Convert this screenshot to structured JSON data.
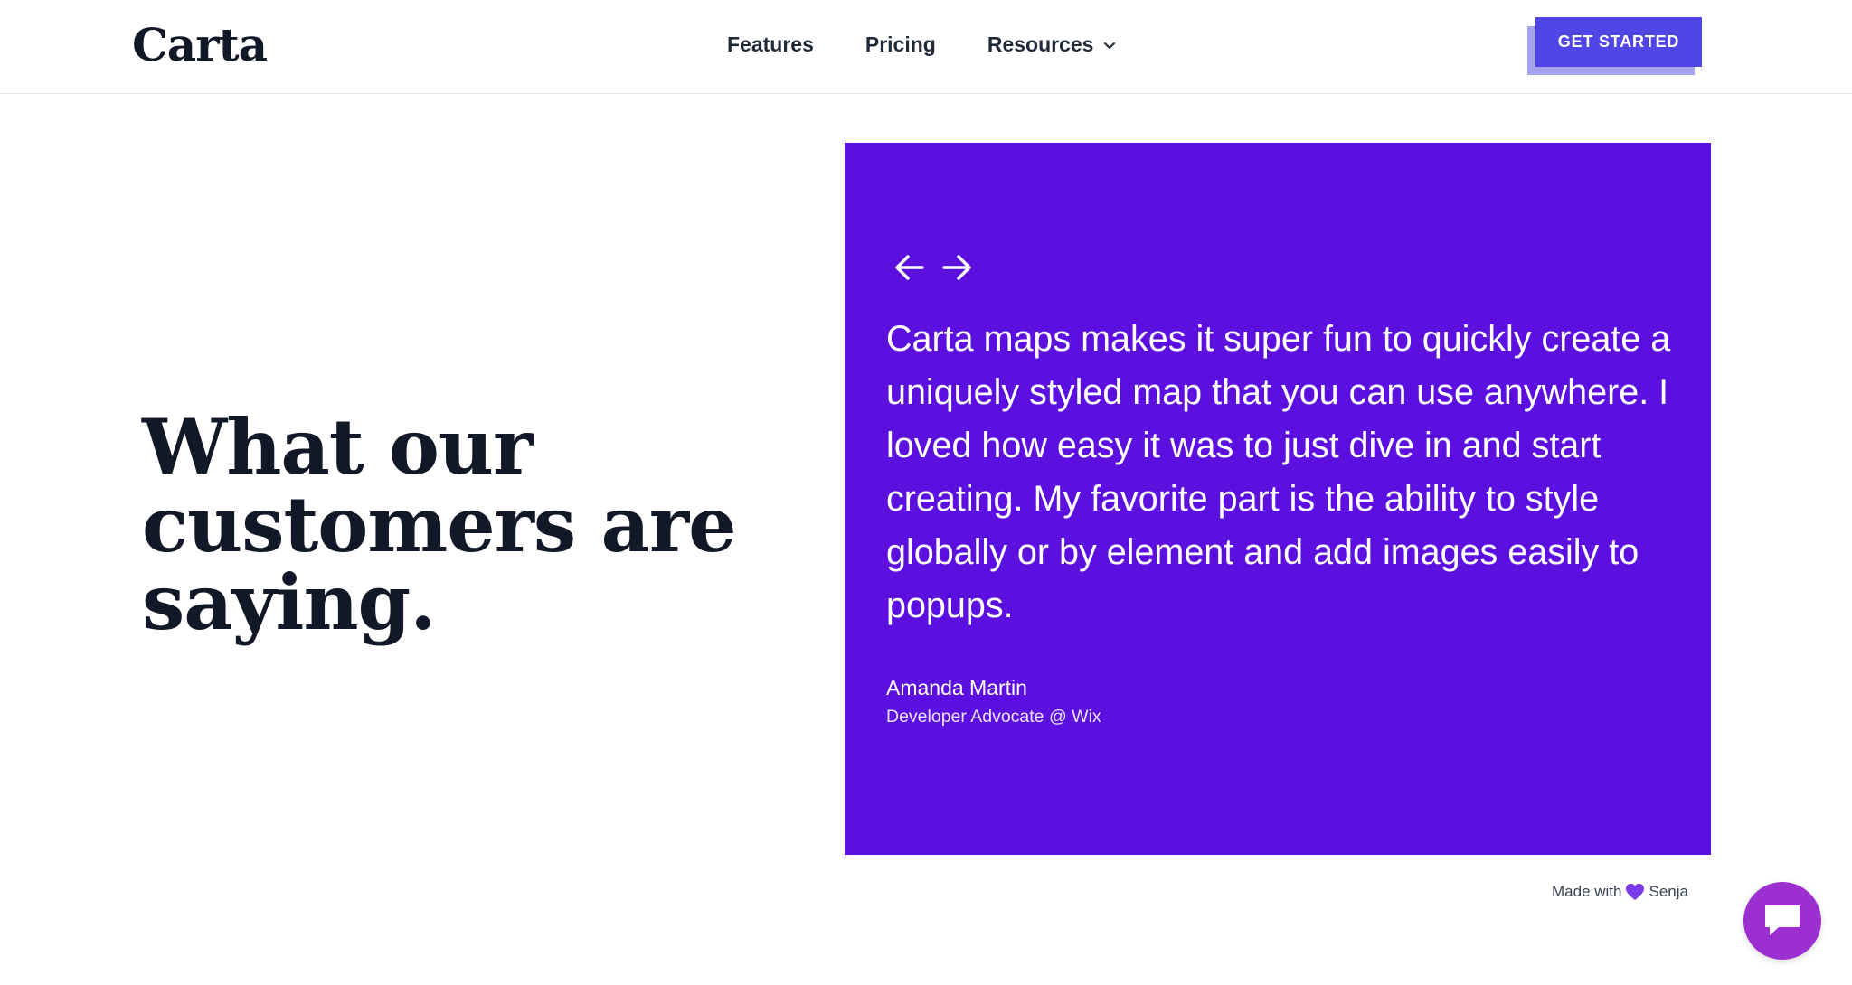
{
  "header": {
    "logo": "Carta",
    "nav": [
      {
        "label": "Features"
      },
      {
        "label": "Pricing"
      },
      {
        "label": "Resources",
        "has_dropdown": true
      }
    ],
    "cta_label": "GET STARTED"
  },
  "hero": {
    "heading_line1": "What our",
    "heading_highlight": "customers",
    "heading_line2_rest": " are",
    "heading_line3": "saying."
  },
  "testimonial": {
    "quote": "Carta maps makes it super fun to quickly create a uniquely styled map that you can use anywhere. I loved how easy it was to just dive in and start creating. My favorite part is the ability to style globally or by element and add images easily to popups.",
    "author_name": "Amanda Martin",
    "author_title": "Developer Advocate @ Wix",
    "prev_icon": "arrow-left-icon",
    "next_icon": "arrow-right-icon"
  },
  "badge": {
    "prefix": "Made with",
    "brand": "Senja",
    "icon": "heart-icon"
  },
  "chat": {
    "icon": "chat-bubble-icon"
  },
  "colors": {
    "text": "#111827",
    "accent": "#4f46e5",
    "card_bg": "#5c10df",
    "highlight": "#d6ebe3",
    "chat_bg": "#9b2fcf",
    "heart": "#7c3aed"
  }
}
